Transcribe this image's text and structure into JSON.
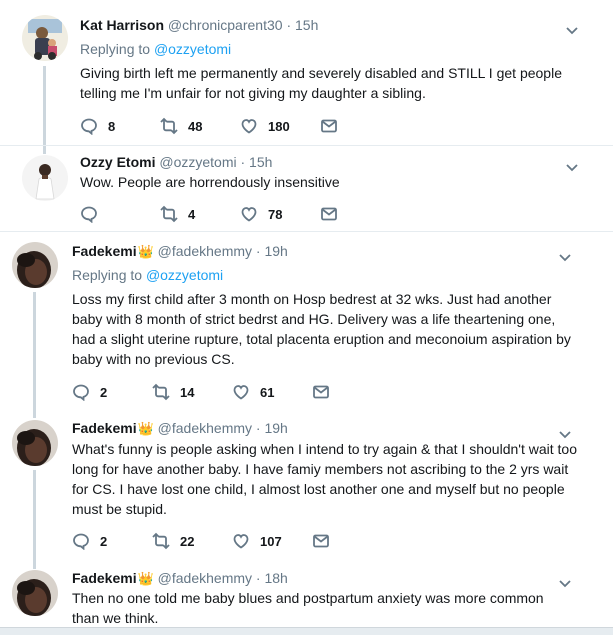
{
  "tweets": [
    {
      "name": "Kat Harrison",
      "handle": "@chronicparent30",
      "time": "15h",
      "replying_label": "Replying to",
      "replying_to": "@ozzyetomi",
      "text": "Giving birth left me permanently and severely disabled and STILL I get people telling me I'm unfair for not giving my daughter a sibling.",
      "replies": "8",
      "retweets": "48",
      "likes": "180"
    },
    {
      "name": "Ozzy Etomi",
      "handle": "@ozzyetomi",
      "time": "15h",
      "text": "Wow. People are horrendously insensitive",
      "replies": "",
      "retweets": "4",
      "likes": "78"
    },
    {
      "name": "Fadekemi",
      "handle": "@fadekhemmy",
      "time": "19h",
      "replying_label": "Replying to",
      "replying_to": "@ozzyetomi",
      "text": "Loss my first child after 3 month on Hosp bedrest at 32 wks. Just had another baby with 8 month of strict bedrst and HG. Delivery was a life theartening one, had a slight uterine rupture, total placenta eruption and meconoium aspiration by baby with no previous CS.",
      "replies": "2",
      "retweets": "14",
      "likes": "61"
    },
    {
      "name": "Fadekemi",
      "handle": "@fadekhemmy",
      "time": "19h",
      "text": "What's funny is people asking when I intend to try again & that I shouldn't wait too long for have another baby. I have famiy members not ascribing to the 2 yrs wait for CS. I have lost one child, I almost lost another one and myself but no people must be stupid.",
      "replies": "2",
      "retweets": "22",
      "likes": "107"
    },
    {
      "name": "Fadekemi",
      "handle": "@fadekhemmy",
      "time": "18h",
      "text": "Then no one told me baby blues and postpartum anxiety was more common than we think."
    }
  ],
  "separator": "·",
  "crown_glyph": "👑",
  "colors": {
    "link": "#1da1f2",
    "muted": "#657786",
    "thread_line": "#ccd6dd"
  }
}
